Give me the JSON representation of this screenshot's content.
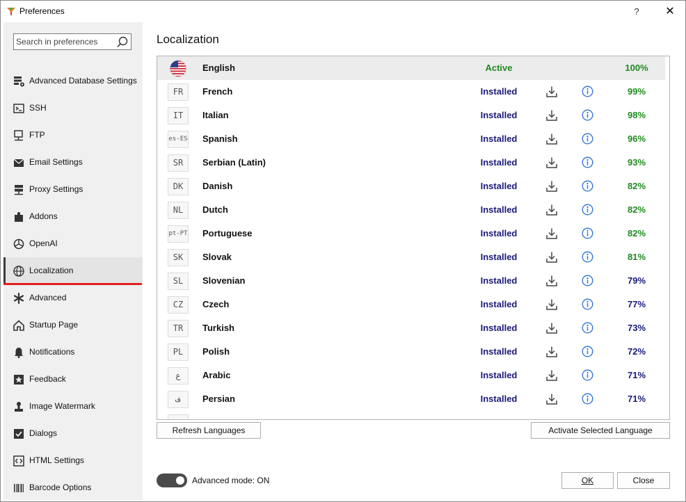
{
  "window": {
    "title": "Preferences",
    "help_glyph": "?",
    "close_glyph": "✕"
  },
  "sidebar": {
    "search_placeholder": "Search in preferences",
    "items": [
      {
        "label": "Advanced Database Settings",
        "icon": "database-settings-icon"
      },
      {
        "label": "SSH",
        "icon": "terminal-icon"
      },
      {
        "label": "FTP",
        "icon": "ftp-icon"
      },
      {
        "label": "Email Settings",
        "icon": "envelope-icon"
      },
      {
        "label": "Proxy Settings",
        "icon": "network-icon"
      },
      {
        "label": "Addons",
        "icon": "puzzle-icon"
      },
      {
        "label": "OpenAI",
        "icon": "openai-icon"
      },
      {
        "label": "Localization",
        "icon": "globe-icon",
        "selected": true
      },
      {
        "label": "Advanced",
        "icon": "asterisk-icon"
      },
      {
        "label": "Startup Page",
        "icon": "home-icon"
      },
      {
        "label": "Notifications",
        "icon": "bell-icon"
      },
      {
        "label": "Feedback",
        "icon": "star-icon"
      },
      {
        "label": "Image Watermark",
        "icon": "person-stamp-icon"
      },
      {
        "label": "Dialogs",
        "icon": "checkbox-icon"
      },
      {
        "label": "HTML Settings",
        "icon": "code-icon"
      },
      {
        "label": "Barcode Options",
        "icon": "barcode-icon"
      }
    ]
  },
  "main": {
    "title": "Localization",
    "languages": [
      {
        "code": "",
        "name": "English",
        "status": "Active",
        "percent": "100%"
      },
      {
        "code": "FR",
        "name": "French",
        "status": "Installed",
        "percent": "99%"
      },
      {
        "code": "IT",
        "name": "Italian",
        "status": "Installed",
        "percent": "98%"
      },
      {
        "code": "es-ES",
        "name": "Spanish",
        "status": "Installed",
        "percent": "96%"
      },
      {
        "code": "SR",
        "name": "Serbian (Latin)",
        "status": "Installed",
        "percent": "93%"
      },
      {
        "code": "DK",
        "name": "Danish",
        "status": "Installed",
        "percent": "82%"
      },
      {
        "code": "NL",
        "name": "Dutch",
        "status": "Installed",
        "percent": "82%"
      },
      {
        "code": "pt-PT",
        "name": "Portuguese",
        "status": "Installed",
        "percent": "82%"
      },
      {
        "code": "SK",
        "name": "Slovak",
        "status": "Installed",
        "percent": "81%"
      },
      {
        "code": "SL",
        "name": "Slovenian",
        "status": "Installed",
        "percent": "79%"
      },
      {
        "code": "CZ",
        "name": "Czech",
        "status": "Installed",
        "percent": "77%"
      },
      {
        "code": "TR",
        "name": "Turkish",
        "status": "Installed",
        "percent": "73%"
      },
      {
        "code": "PL",
        "name": "Polish",
        "status": "Installed",
        "percent": "72%"
      },
      {
        "code": "ع",
        "name": "Arabic",
        "status": "Installed",
        "percent": "71%"
      },
      {
        "code": "ف",
        "name": "Persian",
        "status": "Installed",
        "percent": "71%"
      }
    ],
    "refresh_button": "Refresh Languages",
    "activate_button": "Activate Selected Language",
    "advanced_mode_label": "Advanced mode: ON",
    "advanced_mode_on": true,
    "ok_button": "OK",
    "close_button": "Close"
  },
  "colors": {
    "active_status": "#1f8a1f",
    "installed_status": "#1a1a7a",
    "info_icon": "#2a6fd6",
    "selection_underline": "#e02020"
  }
}
